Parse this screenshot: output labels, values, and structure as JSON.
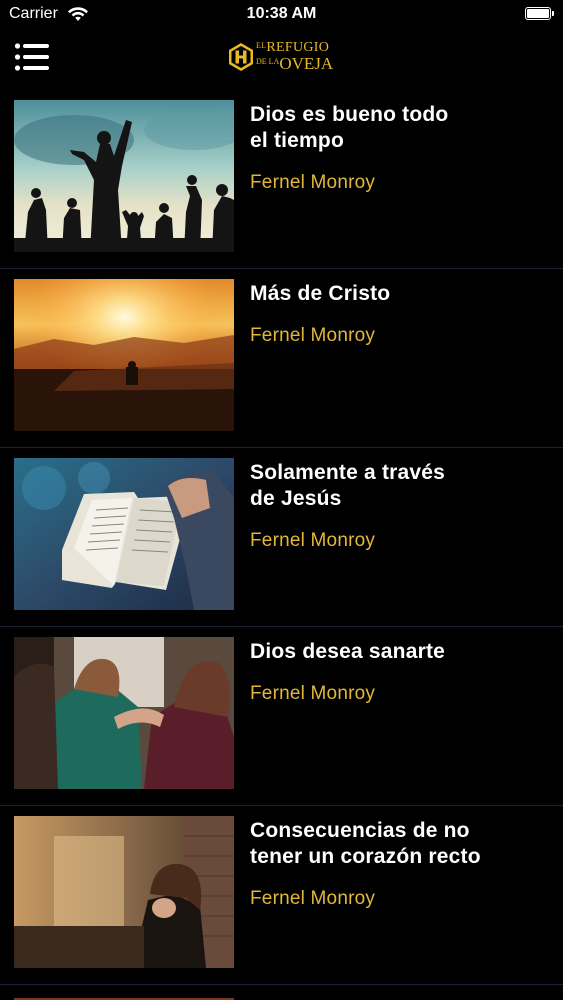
{
  "status_bar": {
    "carrier": "Carrier",
    "time": "10:38 AM",
    "battery_level": 1.0
  },
  "header": {
    "menu_icon": "hamburger-menu-icon",
    "logo": {
      "line1_small": "EL",
      "line1": "REFUGIO",
      "line2_small": "DE LA",
      "line2": "OVEJA"
    }
  },
  "colors": {
    "background": "#000000",
    "accent": "#e2b73a",
    "divider": "#1a2233"
  },
  "sermons": [
    {
      "title_lines": [
        "Dios es bueno todo",
        "el tiempo"
      ],
      "author": "Fernel Monroy"
    },
    {
      "title_lines": [
        "Más de Cristo"
      ],
      "author": "Fernel Monroy"
    },
    {
      "title_lines": [
        "Solamente a través",
        "de Jesús"
      ],
      "author": "Fernel Monroy"
    },
    {
      "title_lines": [
        "Dios desea sanarte"
      ],
      "author": "Fernel Monroy"
    },
    {
      "title_lines": [
        "Consecuencias de no",
        "tener un corazón recto"
      ],
      "author": "Fernel Monroy"
    }
  ]
}
